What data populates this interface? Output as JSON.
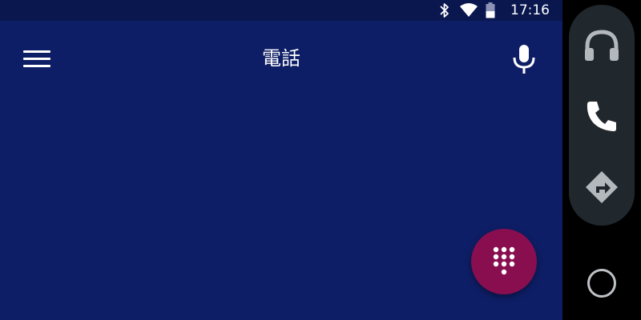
{
  "status_bar": {
    "time": "17:16",
    "icons": [
      "bluetooth-icon",
      "wifi-icon",
      "battery-icon"
    ]
  },
  "app_bar": {
    "title": "電話",
    "left_icon": "menu-icon",
    "right_icon": "microphone-icon"
  },
  "fab": {
    "icon": "dialpad-icon",
    "color": "#880e4f"
  },
  "rail": {
    "items": [
      {
        "icon": "headphones-icon"
      },
      {
        "icon": "phone-icon"
      },
      {
        "icon": "navigation-icon"
      }
    ],
    "home_icon": "home-circle-icon"
  },
  "colors": {
    "background": "#0e1e66",
    "status_bar": "#0a174f",
    "rail": "#21282d",
    "accent": "#880e4f"
  }
}
